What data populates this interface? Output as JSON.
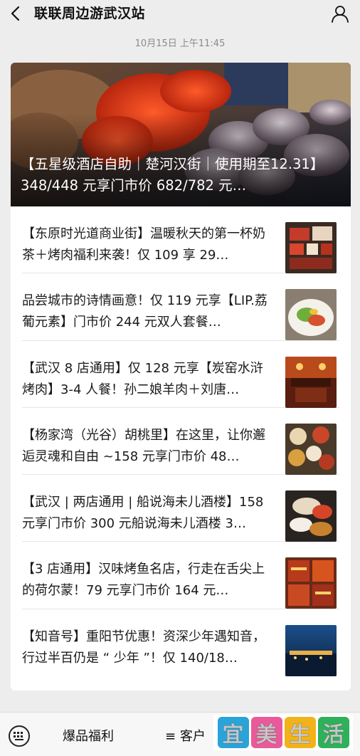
{
  "header": {
    "title": "联联周边游武汉站",
    "back_icon": "chevron-left-icon",
    "profile_icon": "person-icon"
  },
  "timestamp": "10月15日 上午11:45",
  "hero": {
    "title": "【五星级酒店自助｜楚河汉街｜使用期至12.31】348/448 元享门市价 682/782 元…"
  },
  "articles": [
    {
      "title": "【东原时光道商业街】温暖秋天的第一杯奶茶＋烤肉福利来袭！仅 109 享 29…"
    },
    {
      "title": "品尝城市的诗情画意！仅 119 元享【LIP.荔葡元素】门市价 244 元双人套餐…"
    },
    {
      "title": "【武汉 8 店通用】仅 128 元享【炭窑水浒烤肉】3-4 人餐！孙二娘羊肉＋刘唐…"
    },
    {
      "title": "【杨家湾（光谷）胡桃里】在这里，让你邂逅灵魂和自由 ~158 元享门市价 48…"
    },
    {
      "title": "【武汉 | 两店通用 | 船说海未儿酒楼】158 元享门市价 300 元船说海未儿酒楼 3…"
    },
    {
      "title": "【3 店通用】汉味烤鱼名店，行走在舌尖上的荷尔蒙！79 元享门市价 164 元…"
    },
    {
      "title": "【知音号】重阳节优惠！资深少年遇知音，行过半百仍是 “ 少年 ”！仅 140/18…"
    }
  ],
  "bottom_bar": {
    "keyboard_icon": "keyboard-icon",
    "menu1": "爆品福利",
    "menu2_prefix": "≡",
    "menu2": "客户",
    "watermark": [
      "宜",
      "美",
      "生",
      "活"
    ]
  },
  "colors": {
    "background": "#ededed",
    "card": "#ffffff",
    "watermark": [
      "#2aa3d8",
      "#e85a9a",
      "#f2b31a",
      "#2fb05a"
    ]
  }
}
